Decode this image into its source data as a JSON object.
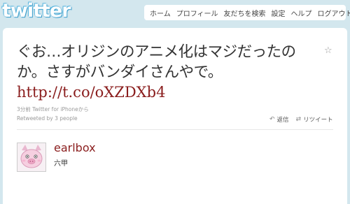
{
  "logo": "twitter",
  "nav": [
    "ホーム",
    "プロフィール",
    "友だちを検索",
    "設定",
    "ヘルプ",
    "ログアウト"
  ],
  "tweet": {
    "text": "ぐお…オリジンのアニメ化はマジだったのか。さすがバンダイさんやで。",
    "link": "http://t.co/oXZDXb4",
    "meta": "3分前 Twitter for iPhoneから",
    "retweeted": "Retweeted by 3 people",
    "reply_label": "返信",
    "retweet_label": "リツイート"
  },
  "user": {
    "username": "earlbox",
    "name": "六甲"
  },
  "colors": {
    "background": "#d3e7ee",
    "link": "#8a1d1d"
  }
}
